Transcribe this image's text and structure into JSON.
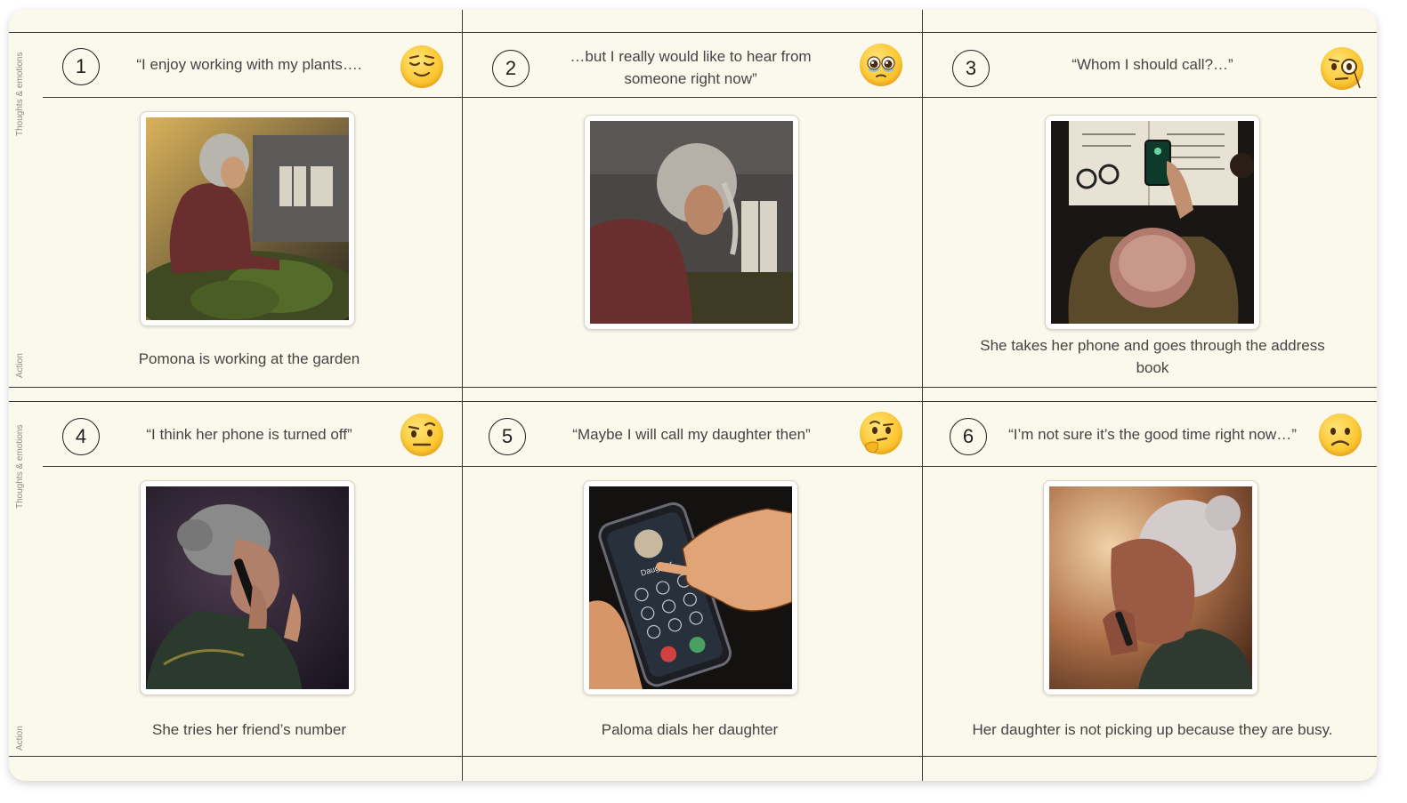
{
  "row_labels": {
    "thoughts": "Thoughts & emotions",
    "action": "Action"
  },
  "steps": [
    {
      "number": "1",
      "thought": "“I enjoy working with my plants….",
      "emotion": "relieved-face-icon",
      "image": "woman-gardening-image",
      "action": "Pomona is working at the garden"
    },
    {
      "number": "2",
      "thought": "…but I really would like to hear from someone right now”",
      "emotion": "pleading-face-icon",
      "image": "woman-head-down-image",
      "action": ""
    },
    {
      "number": "3",
      "thought": "“Whom I should call?…”",
      "emotion": "face-with-monocle-icon",
      "image": "phone-address-book-image",
      "action": "She takes her phone and goes through the address book"
    },
    {
      "number": "4",
      "thought": "“I think her phone is turned off”",
      "emotion": "raised-eyebrow-face-icon",
      "image": "woman-on-phone-image",
      "action": "She tries her friend’s number"
    },
    {
      "number": "5",
      "thought": "“Maybe I will call my daughter then”",
      "emotion": "thinking-face-icon",
      "image": "dialing-phone-image",
      "action": "Paloma dials her daughter"
    },
    {
      "number": "6",
      "thought": "“I’m not sure it’s the good time right now…”",
      "emotion": "frowning-face-icon",
      "image": "woman-worried-phone-image",
      "action": "Her daughter is not picking up because they are busy."
    }
  ],
  "illustration_text": {
    "phone_contact": "Daughter"
  },
  "colors": {
    "board": "#fbf8ec",
    "lines": "#3a3a3a",
    "text": "#444444",
    "emoji": "#fcc934"
  }
}
